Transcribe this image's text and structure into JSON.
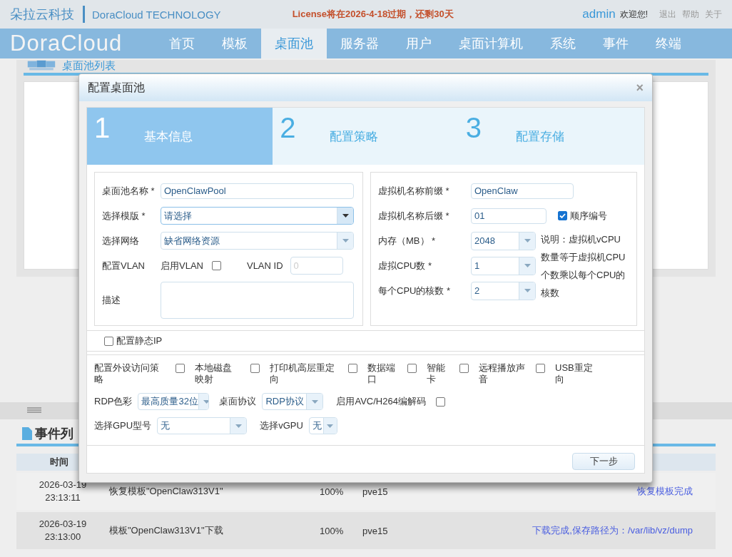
{
  "header": {
    "brand_cn": "朵拉云科技",
    "brand_en": "DoraCloud TECHNOLOGY",
    "license_notice": "License将在2026-4-18过期，还剩30天",
    "user": "admin",
    "welcome": "欢迎您!",
    "links": [
      "退出",
      "帮助",
      "关于"
    ]
  },
  "nav": {
    "logo": "DoraCloud",
    "items": [
      {
        "label": "首页",
        "selected": false
      },
      {
        "label": "模板",
        "selected": false
      },
      {
        "label": "桌面池",
        "selected": true
      },
      {
        "label": "服务器",
        "selected": false
      },
      {
        "label": "用户",
        "selected": false
      },
      {
        "label": "桌面计算机",
        "selected": false
      },
      {
        "label": "系统",
        "selected": false
      },
      {
        "label": "事件",
        "selected": false
      },
      {
        "label": "终端",
        "selected": false
      }
    ]
  },
  "pool_list": {
    "title": "桌面池列表"
  },
  "events": {
    "title": "事件列",
    "columns": [
      "时间"
    ],
    "rows": [
      {
        "date": "2026-03-19",
        "time": "23:13:11",
        "description": "恢复模板\"OpenClaw313V1\"",
        "progress": "100%",
        "server": "pve15",
        "result": "恢复模板完成"
      },
      {
        "date": "2026-03-19",
        "time": "23:13:00",
        "description": "模板\"OpenClaw313V1\"下载",
        "progress": "100%",
        "server": "pve15",
        "result": "下载完成,保存路径为：/var/lib/vz/dump"
      }
    ]
  },
  "dialog": {
    "title": "配置桌面池",
    "close": "×",
    "steps": [
      {
        "number": "1",
        "label": "基本信息",
        "selected": true
      },
      {
        "number": "2",
        "label": "配置策略",
        "selected": false
      },
      {
        "number": "3",
        "label": "配置存储",
        "selected": false
      }
    ],
    "left_fields": [
      {
        "kind": "text",
        "label": "桌面池名称 *",
        "value": "OpenClawPool"
      },
      {
        "kind": "select",
        "label": "选择模版 *",
        "value": "请选择",
        "focused": true
      },
      {
        "kind": "select",
        "label": "选择网络",
        "value": "缺省网络资源",
        "focused": false
      },
      {
        "kind": "vlan",
        "label": "配置VLAN",
        "enable_label": "启用VLAN",
        "checked": false,
        "id_label": "VLAN ID",
        "id_placeholder": "0"
      },
      {
        "kind": "textarea",
        "label": "描述"
      }
    ],
    "right_fields": [
      {
        "kind": "text",
        "label": "虚拟机名称前缀 *",
        "value": "OpenClaw"
      },
      {
        "kind": "suffix",
        "label": "虚拟机名称后缀 *",
        "value": "01",
        "check_label": "顺序编号",
        "checked": true
      },
      {
        "kind": "select",
        "label": "内存（MB） *",
        "value": "2048"
      },
      {
        "kind": "select",
        "label": "虚拟CPU数 *",
        "value": "1"
      },
      {
        "kind": "select",
        "label": "每个CPU的核数 *",
        "value": "2"
      }
    ],
    "cpu_note": "说明：虚拟机vCPU数量等于虚拟机CPU个数乘以每个CPU的核数",
    "static_ip": {
      "label": "配置静态IP",
      "checked": false
    },
    "peripherals": {
      "label": "配置外设访问策略",
      "options": [
        {
          "label": "本地磁盘映射",
          "checked": false
        },
        {
          "label": "打印机高层重定向",
          "checked": false
        },
        {
          "label": "数据端口",
          "checked": false
        },
        {
          "label": "智能卡",
          "checked": false
        },
        {
          "label": "远程播放声音",
          "checked": false
        },
        {
          "label": "USB重定向",
          "checked": false
        }
      ]
    },
    "rdp_color": {
      "label": "RDP色彩",
      "value": "最高质量32位"
    },
    "protocol": {
      "label": "桌面协议",
      "value": "RDP协议"
    },
    "avc": {
      "label": "启用AVC/H264编解码",
      "checked": false
    },
    "gpu": {
      "label": "选择GPU型号",
      "value": "无"
    },
    "vgpu": {
      "label": "选择vGPU",
      "value": "无"
    },
    "next_button": "下一步"
  }
}
